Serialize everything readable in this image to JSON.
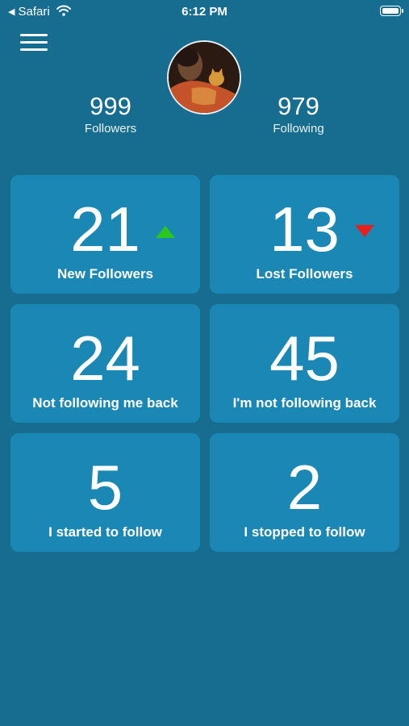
{
  "status_bar": {
    "back_label": "Safari",
    "time": "6:12 PM"
  },
  "profile": {
    "followers_count": "999",
    "followers_label": "Followers",
    "following_count": "979",
    "following_label": "Following"
  },
  "cards": [
    {
      "number": "21",
      "label": "New Followers",
      "trend": "up"
    },
    {
      "number": "13",
      "label": "Lost Followers",
      "trend": "down"
    },
    {
      "number": "24",
      "label": "Not following me back"
    },
    {
      "number": "45",
      "label": "I'm not following back"
    },
    {
      "number": "5",
      "label": "I started to follow"
    },
    {
      "number": "2",
      "label": "I stopped to follow"
    }
  ],
  "colors": {
    "background": "#176d8f",
    "card": "#1b87b5",
    "trend_up": "#2bc71e",
    "trend_down": "#e8201c"
  }
}
